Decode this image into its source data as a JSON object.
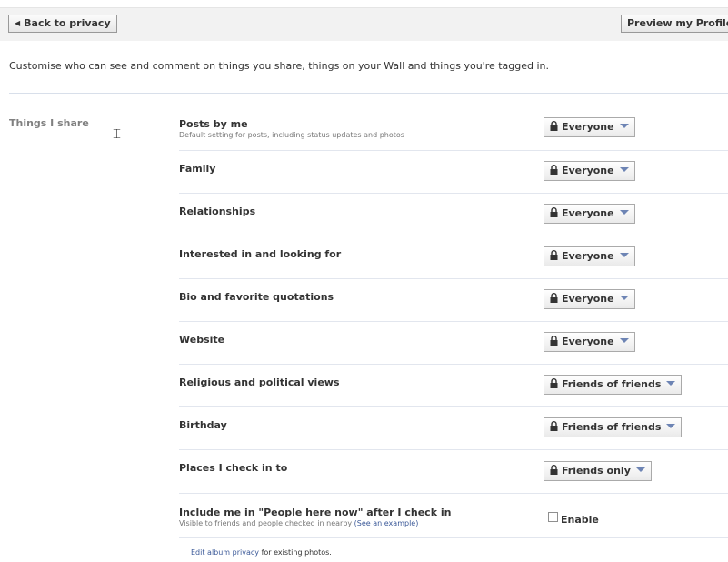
{
  "toolbar": {
    "back_label": "Back to privacy",
    "preview_label": "Preview my Profile"
  },
  "intro": "Customise who can see and comment on things you share, things on your Wall and things you're tagged in.",
  "section": {
    "label": "Things I share"
  },
  "rows": [
    {
      "title": "Posts by me",
      "subtitle": "Default setting for posts, including status updates and photos",
      "setting": "Everyone"
    },
    {
      "title": "Family",
      "setting": "Everyone"
    },
    {
      "title": "Relationships",
      "setting": "Everyone"
    },
    {
      "title": "Interested in and looking for",
      "setting": "Everyone"
    },
    {
      "title": "Bio and favorite quotations",
      "setting": "Everyone"
    },
    {
      "title": "Website",
      "setting": "Everyone"
    },
    {
      "title": "Religious and political views",
      "setting": "Friends of friends"
    },
    {
      "title": "Birthday",
      "setting": "Friends of friends"
    },
    {
      "title": "Places I check in to",
      "setting": "Friends only"
    }
  ],
  "checkin_row": {
    "title": "Include me in \"People here now\" after I check in",
    "subtitle": "Visible to friends and people checked in nearby",
    "link": "(See an example)",
    "checkbox_label": "Enable",
    "checked": false
  },
  "footer": {
    "link": "Edit album privacy",
    "text": "for existing photos."
  },
  "icons": {
    "back": "back-arrow-icon",
    "lock": "lock-icon",
    "dropdown": "chevron-down-icon",
    "cursor": "text-cursor-icon"
  },
  "colors": {
    "link": "#3b5998",
    "caret": "#6d84b4",
    "divider": "#e2e6ee"
  }
}
